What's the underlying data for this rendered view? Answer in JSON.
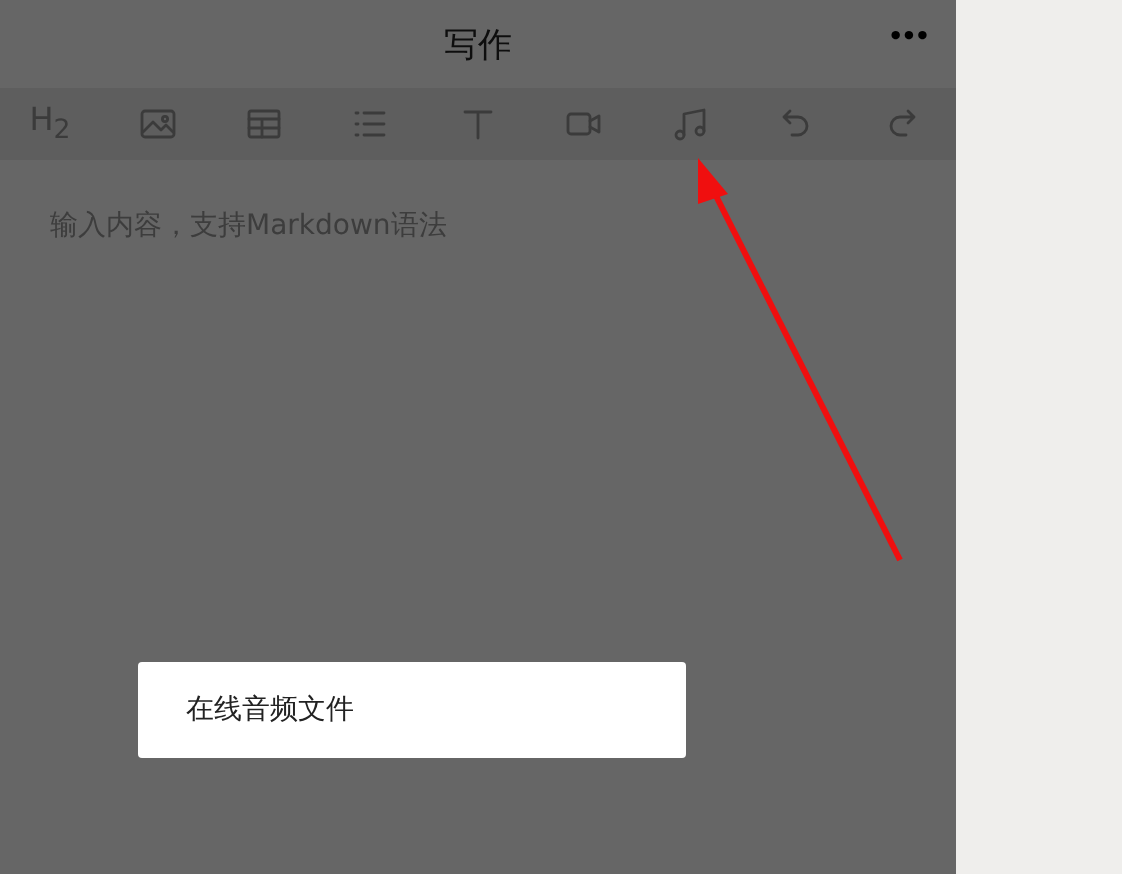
{
  "header": {
    "title": "写作",
    "menu": "•••"
  },
  "toolbar": [
    {
      "kind": "heading",
      "label": "H$_{2}$"
    },
    {
      "kind": "image"
    },
    {
      "kind": "table"
    },
    {
      "kind": "list"
    },
    {
      "kind": "text"
    },
    {
      "kind": "video"
    },
    {
      "kind": "audio"
    },
    {
      "kind": "undo"
    },
    {
      "kind": "redo"
    }
  ],
  "editor": {
    "placeholder": "输入内容，支持Markdown语法"
  },
  "popup": {
    "items": [
      "在线音频文件"
    ]
  }
}
